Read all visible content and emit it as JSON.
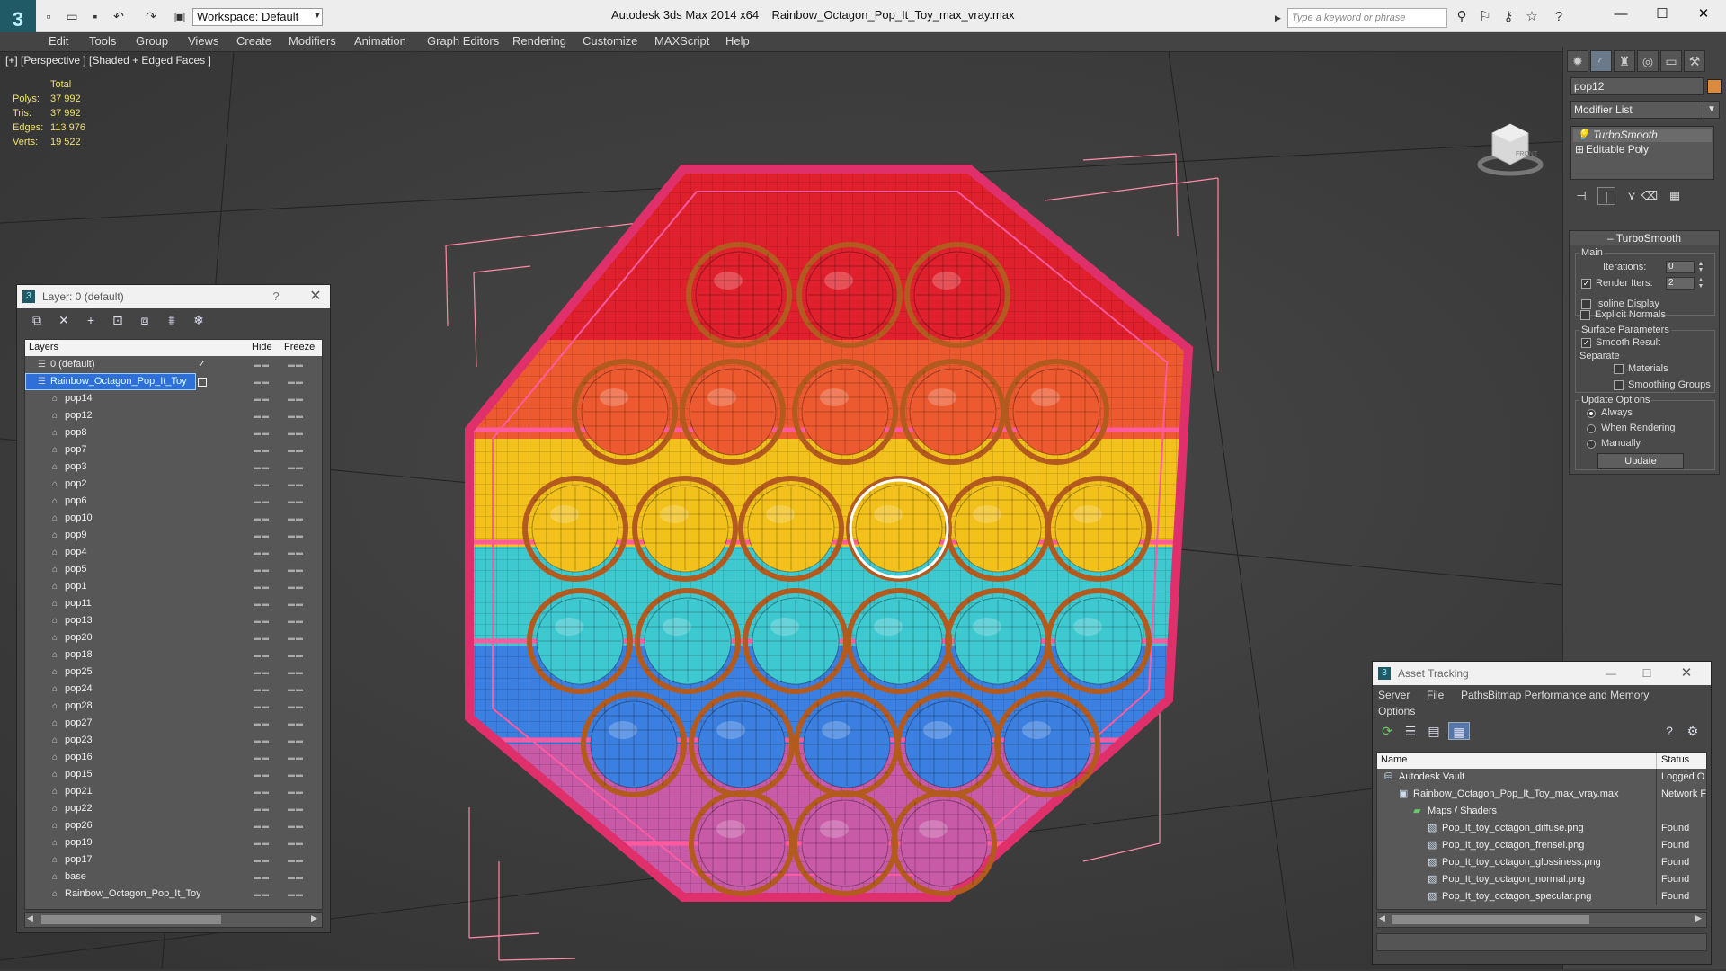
{
  "app": {
    "title": "Autodesk 3ds Max  2014 x64",
    "file": "Rainbow_Octagon_Pop_It_Toy_max_vray.max",
    "workspace": "Workspace: Default",
    "search_placeholder": "Type a keyword or phrase"
  },
  "menu": [
    "Edit",
    "Tools",
    "Group",
    "Views",
    "Create",
    "Modifiers",
    "Animation",
    "Graph Editors",
    "Rendering",
    "Customize",
    "MAXScript",
    "Help"
  ],
  "viewport": {
    "label": "[+] [Perspective ] [Shaded + Edged Faces ]",
    "stats": {
      "total_label": "Total",
      "rows": [
        {
          "label": "Polys:",
          "value": "37 992"
        },
        {
          "label": "Tris:",
          "value": "37 992"
        },
        {
          "label": "Edges:",
          "value": "113 976"
        },
        {
          "label": "Verts:",
          "value": "19 522"
        }
      ]
    },
    "viewcube_label": "FRONT",
    "colors": {
      "red": "#e0202c",
      "orange": "#ee5a30",
      "yellow": "#f2c11c",
      "cyan": "#3ec8d0",
      "blue": "#3b7fe0",
      "pink": "#c85aa8",
      "frame": "#e0306c",
      "wire": "#b35a1f",
      "bbox": "#ff8aa8"
    }
  },
  "command_panel": {
    "object_name": "pop12",
    "modifier_list": "Modifier List",
    "stack": [
      "TurboSmooth",
      "Editable Poly"
    ],
    "turbosmooth": {
      "title": "TurboSmooth",
      "main": "Main",
      "iterations_label": "Iterations:",
      "iterations": "0",
      "render_iters_label": "Render Iters:",
      "render_iters": "2",
      "render_iters_checked": true,
      "isoline": "Isoline Display",
      "explicit_normals": "Explicit Normals",
      "surface_params": "Surface Parameters",
      "smooth_result": "Smooth Result",
      "separate": "Separate",
      "materials": "Materials",
      "smoothing_groups": "Smoothing Groups",
      "update_options": "Update Options",
      "always": "Always",
      "when_rendering": "When Rendering",
      "manually": "Manually",
      "update_button": "Update"
    }
  },
  "layers_window": {
    "title": "Layer: 0 (default)",
    "help": "?",
    "columns": {
      "layers": "Layers",
      "hide": "Hide",
      "freeze": "Freeze"
    },
    "rows": [
      {
        "name": "0 (default)",
        "level": 0,
        "selected": false
      },
      {
        "name": "Rainbow_Octagon_Pop_It_Toy",
        "level": 0,
        "selected": true
      },
      {
        "name": "pop14",
        "level": 1
      },
      {
        "name": "pop12",
        "level": 1
      },
      {
        "name": "pop8",
        "level": 1
      },
      {
        "name": "pop7",
        "level": 1
      },
      {
        "name": "pop3",
        "level": 1
      },
      {
        "name": "pop2",
        "level": 1
      },
      {
        "name": "pop6",
        "level": 1
      },
      {
        "name": "pop10",
        "level": 1
      },
      {
        "name": "pop9",
        "level": 1
      },
      {
        "name": "pop4",
        "level": 1
      },
      {
        "name": "pop5",
        "level": 1
      },
      {
        "name": "pop1",
        "level": 1
      },
      {
        "name": "pop11",
        "level": 1
      },
      {
        "name": "pop13",
        "level": 1
      },
      {
        "name": "pop20",
        "level": 1
      },
      {
        "name": "pop18",
        "level": 1
      },
      {
        "name": "pop25",
        "level": 1
      },
      {
        "name": "pop24",
        "level": 1
      },
      {
        "name": "pop28",
        "level": 1
      },
      {
        "name": "pop27",
        "level": 1
      },
      {
        "name": "pop23",
        "level": 1
      },
      {
        "name": "pop16",
        "level": 1
      },
      {
        "name": "pop15",
        "level": 1
      },
      {
        "name": "pop21",
        "level": 1
      },
      {
        "name": "pop22",
        "level": 1
      },
      {
        "name": "pop26",
        "level": 1
      },
      {
        "name": "pop19",
        "level": 1
      },
      {
        "name": "pop17",
        "level": 1
      },
      {
        "name": "base",
        "level": 1
      },
      {
        "name": "Rainbow_Octagon_Pop_It_Toy",
        "level": 1
      }
    ]
  },
  "asset_window": {
    "title": "Asset Tracking",
    "menu": [
      "Server",
      "File",
      "Paths",
      "Bitmap Performance and Memory"
    ],
    "menu2": "Options",
    "columns": {
      "name": "Name",
      "status": "Status"
    },
    "rows": [
      {
        "name": "Autodesk Vault",
        "status": "Logged O",
        "indent": 0
      },
      {
        "name": "Rainbow_Octagon_Pop_It_Toy_max_vray.max",
        "status": "Network F",
        "indent": 1
      },
      {
        "name": "Maps / Shaders",
        "status": "",
        "indent": 2
      },
      {
        "name": "Pop_It_toy_octagon_diffuse.png",
        "status": "Found",
        "indent": 3
      },
      {
        "name": "Pop_It_toy_octagon_frensel.png",
        "status": "Found",
        "indent": 3
      },
      {
        "name": "Pop_It_toy_octagon_glossiness.png",
        "status": "Found",
        "indent": 3
      },
      {
        "name": "Pop_It_toy_octagon_normal.png",
        "status": "Found",
        "indent": 3
      },
      {
        "name": "Pop_It_toy_octagon_specular.png",
        "status": "Found",
        "indent": 3
      }
    ]
  }
}
